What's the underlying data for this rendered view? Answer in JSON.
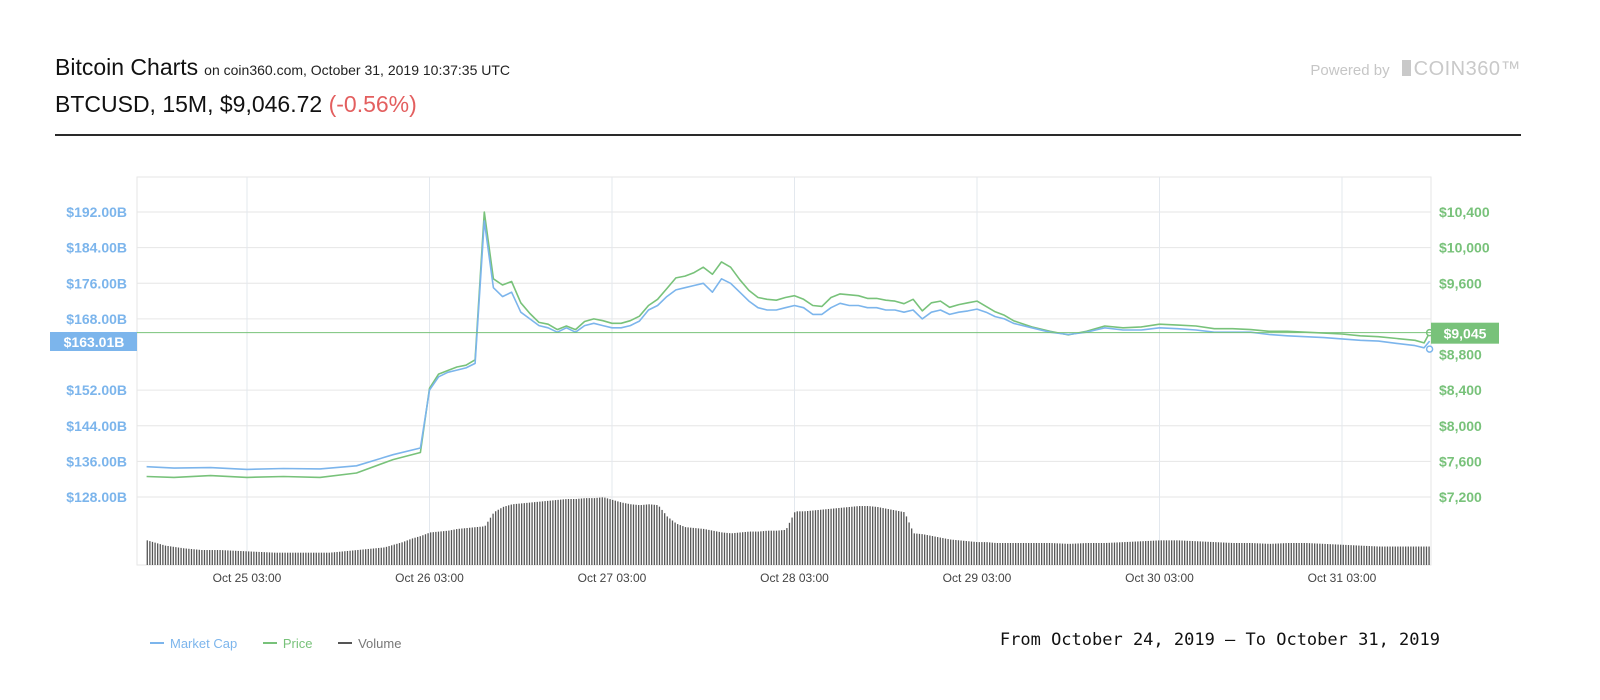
{
  "header": {
    "title": "Bitcoin Charts",
    "subtitle": "on coin360.com, October 31, 2019 10:37:35 UTC",
    "pair": "BTCUSD, 15M, $9,046.72",
    "change": "(-0.56%)",
    "powered_by": "Powered by",
    "logo_text": "COIN360™"
  },
  "footer": {
    "range_text": "From October 24, 2019 – To October 31, 2019"
  },
  "colors": {
    "market_cap": "#7cb5ec",
    "price": "#78c27a",
    "volume": "#555555",
    "change_negative": "#e35f5f"
  },
  "chart_data": {
    "type": "line",
    "x_axis": {
      "ticks": [
        "Oct 25 03:00",
        "Oct 26 03:00",
        "Oct 27 03:00",
        "Oct 28 03:00",
        "Oct 29 03:00",
        "Oct 30 03:00",
        "Oct 31 03:00"
      ]
    },
    "y_left": {
      "unit": "B USD",
      "ticks": [
        192,
        184,
        176,
        168,
        152,
        144,
        136,
        128
      ],
      "tick_labels": [
        "$192.00B",
        "$184.00B",
        "$176.00B",
        "$168.00B",
        "$152.00B",
        "$144.00B",
        "$136.00B",
        "$128.00B"
      ],
      "current_label": "$163.01B",
      "current_value": 163.01
    },
    "y_right": {
      "unit": "USD",
      "ticks": [
        10400,
        10000,
        9600,
        8800,
        8400,
        8000,
        7600,
        7200
      ],
      "tick_labels": [
        "$10,400",
        "$10,000",
        "$9,600",
        "$8,800",
        "$8,400",
        "$8,000",
        "$7,600",
        "$7,200"
      ],
      "current_label": "$9,045",
      "current_value": 9045
    },
    "legend": {
      "placement": "bottom-left",
      "entries": [
        "Market Cap",
        "Price",
        "Volume"
      ]
    },
    "grid": true,
    "series": [
      {
        "name": "Market Cap",
        "axis": "left",
        "x": [
          -0.55,
          -0.4,
          -0.2,
          0,
          0.2,
          0.4,
          0.6,
          0.8,
          0.95,
          1.0,
          1.05,
          1.1,
          1.15,
          1.2,
          1.25,
          1.3,
          1.35,
          1.4,
          1.45,
          1.5,
          1.55,
          1.6,
          1.65,
          1.7,
          1.75,
          1.8,
          1.85,
          1.9,
          1.95,
          2.0,
          2.05,
          2.1,
          2.15,
          2.2,
          2.25,
          2.3,
          2.35,
          2.4,
          2.45,
          2.5,
          2.55,
          2.6,
          2.65,
          2.7,
          2.75,
          2.8,
          2.85,
          2.9,
          2.95,
          3.0,
          3.05,
          3.1,
          3.15,
          3.2,
          3.25,
          3.3,
          3.35,
          3.4,
          3.45,
          3.5,
          3.55,
          3.6,
          3.65,
          3.7,
          3.75,
          3.8,
          3.85,
          3.9,
          3.95,
          4.0,
          4.05,
          4.1,
          4.15,
          4.2,
          4.3,
          4.4,
          4.5,
          4.6,
          4.65,
          4.7,
          4.8,
          4.9,
          5.0,
          5.1,
          5.2,
          5.3,
          5.4,
          5.5,
          5.6,
          5.7,
          5.8,
          5.9,
          6.0,
          6.1,
          6.2,
          6.3,
          6.4,
          6.45,
          6.48
        ],
        "values": [
          134.8,
          134.5,
          134.6,
          134.2,
          134.4,
          134.3,
          135.0,
          137.5,
          139.0,
          152.0,
          155.0,
          156.0,
          156.5,
          157.0,
          158.0,
          190.0,
          175.0,
          173.0,
          174.0,
          169.5,
          168.0,
          166.5,
          166.0,
          165.0,
          166.0,
          165.0,
          166.5,
          167.0,
          166.5,
          166.0,
          166.0,
          166.5,
          167.5,
          170.0,
          171.0,
          173.0,
          174.5,
          175.0,
          175.5,
          176.0,
          174.0,
          177.0,
          176.0,
          174.0,
          172.0,
          170.5,
          170.0,
          170.0,
          170.5,
          171.0,
          170.5,
          169.0,
          169.0,
          170.5,
          171.5,
          171.0,
          171.0,
          170.5,
          170.5,
          170.0,
          170.0,
          169.5,
          170.0,
          168.0,
          169.5,
          170.0,
          169.0,
          169.5,
          169.8,
          170.2,
          169.5,
          168.5,
          168.0,
          167.0,
          166.0,
          165.0,
          164.5,
          165.0,
          165.5,
          166.0,
          165.5,
          165.5,
          166.0,
          165.8,
          165.5,
          165.0,
          165.0,
          165.0,
          164.5,
          164.2,
          164.0,
          163.8,
          163.5,
          163.2,
          163.0,
          162.5,
          162.0,
          161.5,
          163.01
        ]
      },
      {
        "name": "Price",
        "axis": "right",
        "x": [
          -0.55,
          -0.4,
          -0.2,
          0,
          0.2,
          0.4,
          0.6,
          0.8,
          0.95,
          1.0,
          1.05,
          1.1,
          1.15,
          1.2,
          1.25,
          1.3,
          1.35,
          1.4,
          1.45,
          1.5,
          1.55,
          1.6,
          1.65,
          1.7,
          1.75,
          1.8,
          1.85,
          1.9,
          1.95,
          2.0,
          2.05,
          2.1,
          2.15,
          2.2,
          2.25,
          2.3,
          2.35,
          2.4,
          2.45,
          2.5,
          2.55,
          2.6,
          2.65,
          2.7,
          2.75,
          2.8,
          2.85,
          2.9,
          2.95,
          3.0,
          3.05,
          3.1,
          3.15,
          3.2,
          3.25,
          3.3,
          3.35,
          3.4,
          3.45,
          3.5,
          3.55,
          3.6,
          3.65,
          3.7,
          3.75,
          3.8,
          3.85,
          3.9,
          3.95,
          4.0,
          4.05,
          4.1,
          4.15,
          4.2,
          4.3,
          4.4,
          4.5,
          4.6,
          4.65,
          4.7,
          4.8,
          4.9,
          5.0,
          5.1,
          5.2,
          5.3,
          5.4,
          5.5,
          5.6,
          5.7,
          5.8,
          5.9,
          6.0,
          6.1,
          6.2,
          6.3,
          6.4,
          6.45,
          6.48
        ],
        "values": [
          7430,
          7420,
          7440,
          7420,
          7430,
          7420,
          7470,
          7620,
          7700,
          8420,
          8580,
          8620,
          8660,
          8680,
          8740,
          10400,
          9650,
          9580,
          9620,
          9380,
          9260,
          9160,
          9140,
          9080,
          9120,
          9080,
          9170,
          9200,
          9180,
          9150,
          9150,
          9180,
          9230,
          9350,
          9420,
          9540,
          9660,
          9680,
          9720,
          9780,
          9700,
          9840,
          9780,
          9640,
          9520,
          9440,
          9420,
          9410,
          9440,
          9460,
          9420,
          9350,
          9340,
          9440,
          9480,
          9470,
          9460,
          9430,
          9430,
          9410,
          9400,
          9370,
          9420,
          9290,
          9380,
          9400,
          9330,
          9360,
          9380,
          9400,
          9340,
          9280,
          9240,
          9180,
          9110,
          9060,
          9020,
          9060,
          9090,
          9120,
          9100,
          9110,
          9140,
          9130,
          9120,
          9090,
          9090,
          9080,
          9060,
          9060,
          9050,
          9040,
          9030,
          9010,
          9000,
          8980,
          8960,
          8930,
          9045
        ]
      },
      {
        "name": "Volume",
        "axis": "volume",
        "x": [
          -0.55,
          -0.45,
          -0.35,
          -0.25,
          -0.15,
          -0.05,
          0.05,
          0.15,
          0.25,
          0.35,
          0.45,
          0.55,
          0.65,
          0.75,
          0.85,
          0.9,
          0.95,
          1.0,
          1.05,
          1.1,
          1.15,
          1.2,
          1.25,
          1.3,
          1.35,
          1.4,
          1.45,
          1.5,
          1.55,
          1.6,
          1.65,
          1.7,
          1.75,
          1.8,
          1.85,
          1.9,
          1.95,
          2.0,
          2.05,
          2.1,
          2.15,
          2.2,
          2.25,
          2.3,
          2.35,
          2.4,
          2.45,
          2.5,
          2.55,
          2.6,
          2.65,
          2.7,
          2.75,
          2.8,
          2.85,
          2.9,
          2.95,
          3.0,
          3.05,
          3.1,
          3.15,
          3.2,
          3.25,
          3.3,
          3.35,
          3.4,
          3.45,
          3.5,
          3.55,
          3.6,
          3.65,
          3.7,
          3.75,
          3.8,
          3.85,
          3.9,
          3.95,
          4.0,
          4.05,
          4.1,
          4.15,
          4.2,
          4.3,
          4.4,
          4.5,
          4.6,
          4.7,
          4.8,
          4.9,
          5.0,
          5.1,
          5.2,
          5.3,
          5.4,
          5.5,
          5.6,
          5.7,
          5.8,
          5.9,
          6.0,
          6.1,
          6.2,
          6.3,
          6.4,
          6.48
        ],
        "values": [
          0.28,
          0.22,
          0.19,
          0.17,
          0.17,
          0.16,
          0.15,
          0.14,
          0.14,
          0.14,
          0.14,
          0.16,
          0.18,
          0.2,
          0.26,
          0.3,
          0.33,
          0.37,
          0.38,
          0.39,
          0.41,
          0.42,
          0.43,
          0.44,
          0.6,
          0.66,
          0.69,
          0.7,
          0.71,
          0.72,
          0.73,
          0.74,
          0.75,
          0.75,
          0.76,
          0.76,
          0.77,
          0.74,
          0.71,
          0.69,
          0.68,
          0.69,
          0.68,
          0.55,
          0.47,
          0.43,
          0.42,
          0.41,
          0.39,
          0.37,
          0.36,
          0.37,
          0.38,
          0.38,
          0.39,
          0.39,
          0.4,
          0.61,
          0.61,
          0.62,
          0.63,
          0.64,
          0.65,
          0.66,
          0.67,
          0.67,
          0.66,
          0.64,
          0.62,
          0.6,
          0.36,
          0.35,
          0.33,
          0.31,
          0.29,
          0.28,
          0.27,
          0.26,
          0.26,
          0.25,
          0.25,
          0.25,
          0.25,
          0.25,
          0.24,
          0.25,
          0.25,
          0.26,
          0.27,
          0.28,
          0.28,
          0.27,
          0.26,
          0.25,
          0.25,
          0.24,
          0.25,
          0.25,
          0.24,
          0.23,
          0.22,
          0.21,
          0.21,
          0.21,
          0.21
        ]
      }
    ]
  }
}
